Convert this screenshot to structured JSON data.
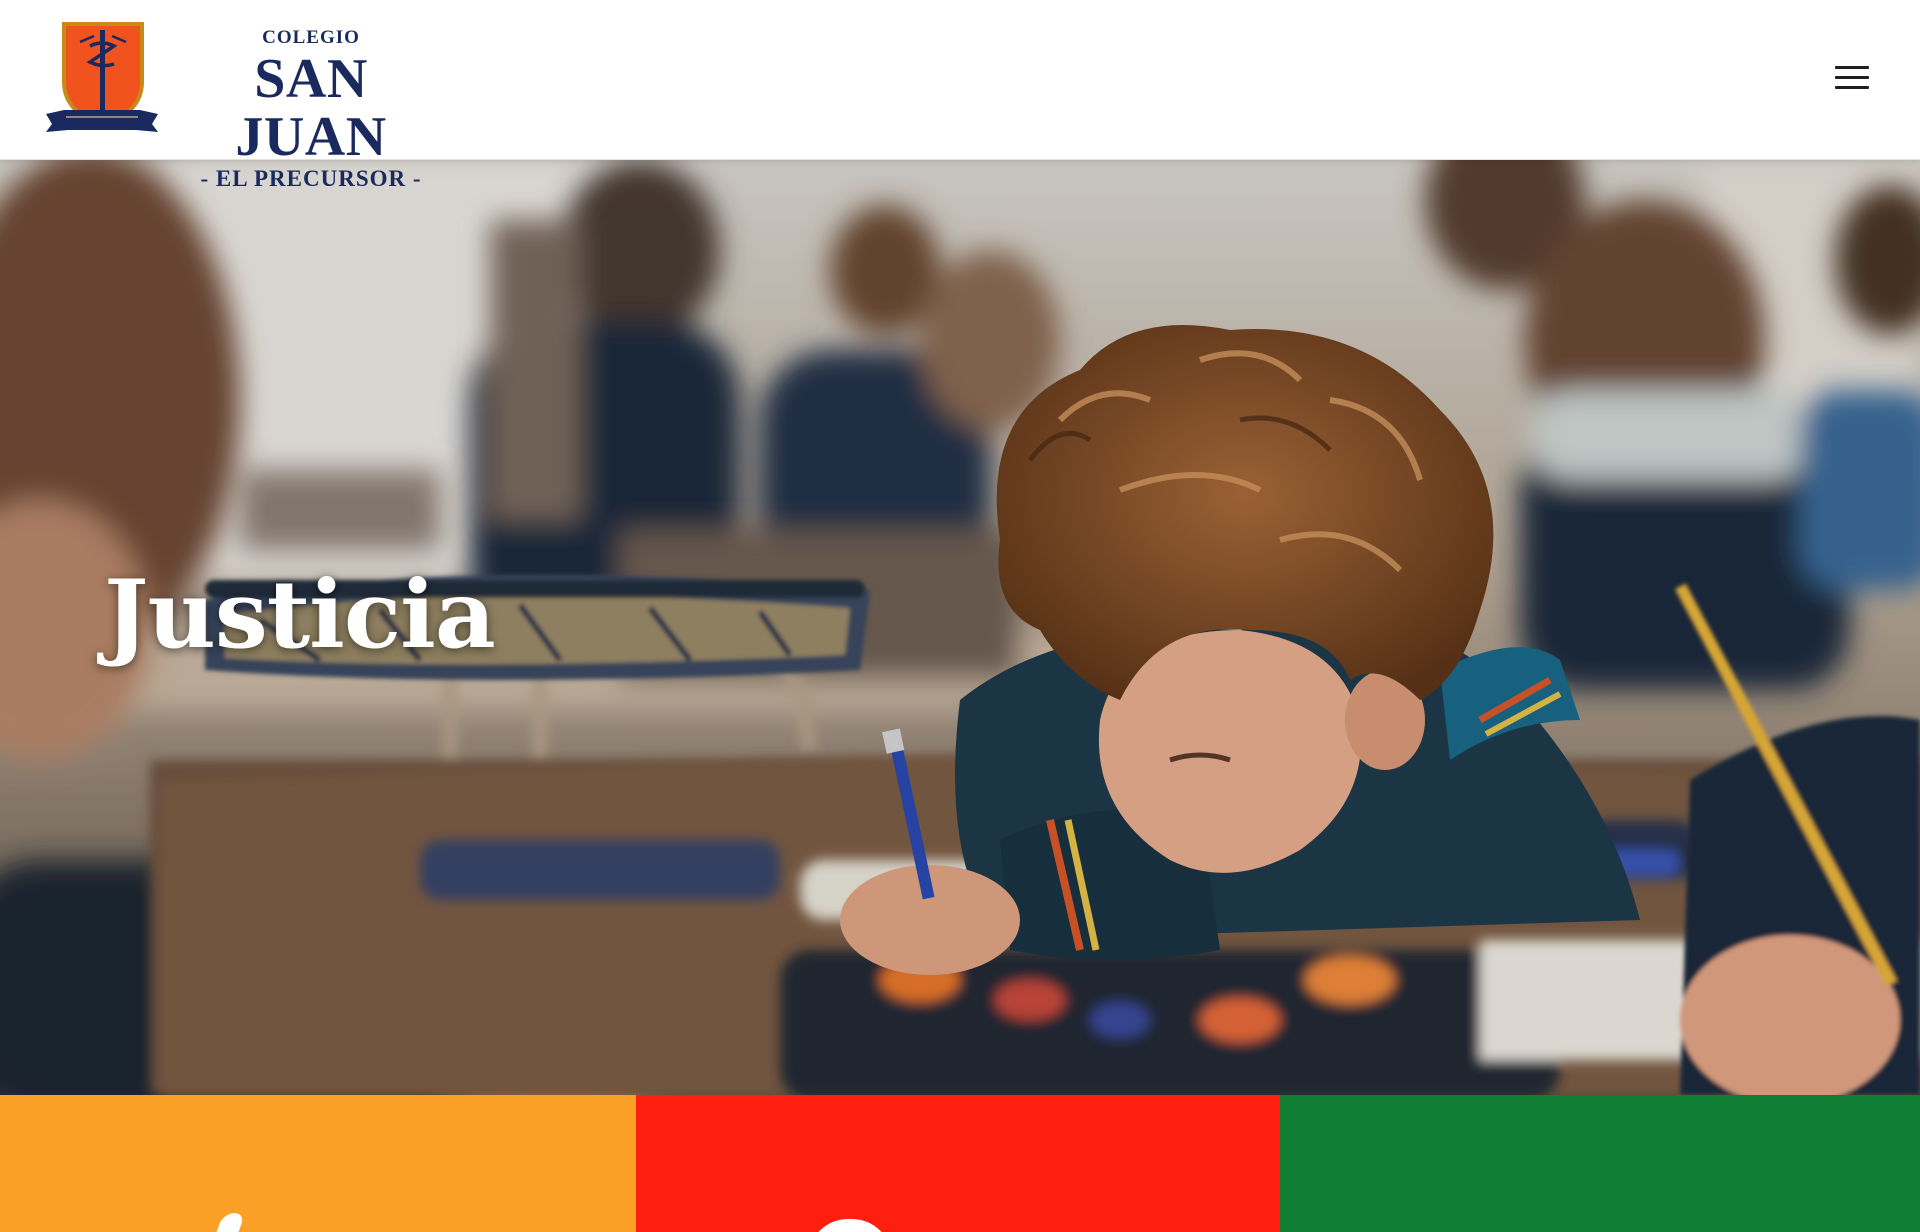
{
  "header": {
    "logo": {
      "line_top": "COLEGIO",
      "line_main": "SAN JUAN",
      "line_sub": "- EL PRECURSOR -"
    },
    "menu_icon": "hamburger-menu-icon"
  },
  "hero": {
    "title": "Justicia"
  },
  "panels": [
    {
      "color": "#fba026"
    },
    {
      "color": "#ff1f0e"
    },
    {
      "color": "#0f7d33"
    }
  ],
  "colors": {
    "brand_navy": "#1a2a5e",
    "crest_orange": "#f0531d"
  }
}
